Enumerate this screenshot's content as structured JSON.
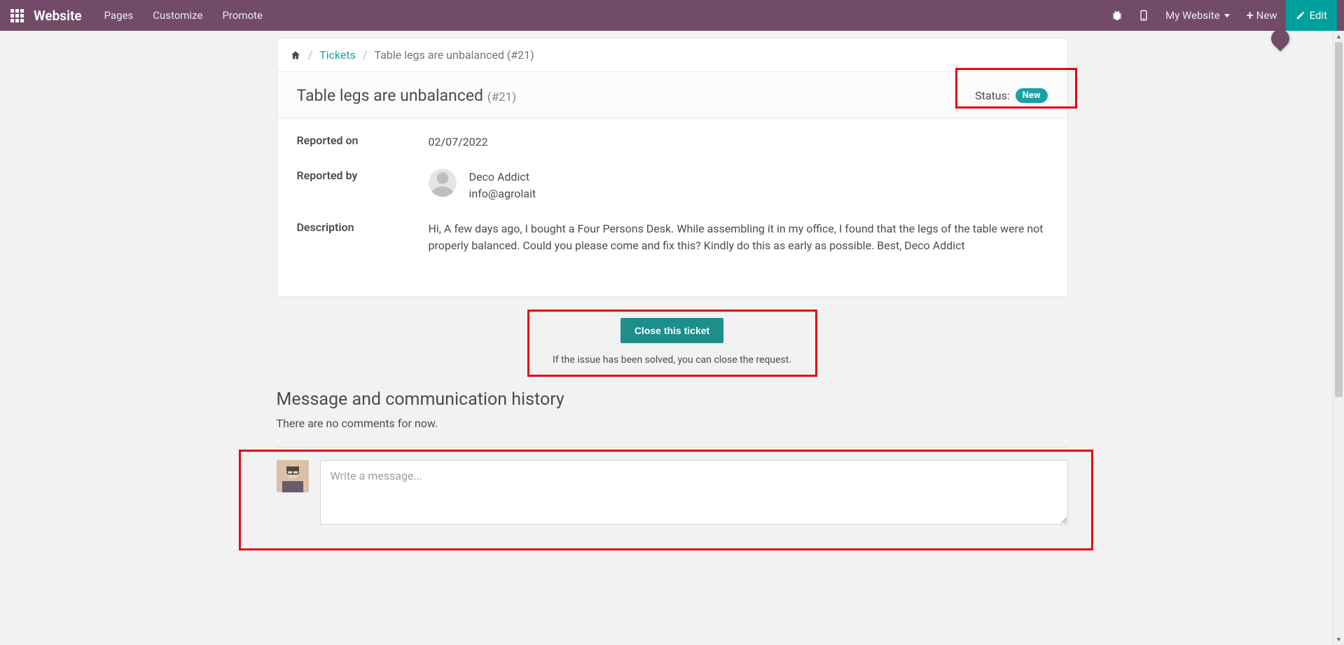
{
  "nav": {
    "brand": "Website",
    "items": [
      "Pages",
      "Customize",
      "Promote"
    ],
    "my_website": "My Website",
    "new_label": "New",
    "edit_label": "Edit"
  },
  "breadcrumb": {
    "home_aria": "Home",
    "tickets": "Tickets",
    "current": "Table legs are unbalanced (#21)"
  },
  "ticket": {
    "title": "Table legs are unbalanced",
    "id_suffix": "(#21)",
    "status_label": "Status:",
    "status_value": "New",
    "fields": {
      "reported_on_label": "Reported on",
      "reported_on_value": "02/07/2022",
      "reported_by_label": "Reported by",
      "reporter_name": "Deco Addict",
      "reporter_email": "info@agrolait",
      "description_label": "Description",
      "description_value": "Hi, A few days ago, I bought a Four Persons Desk. While assembling it in my office, I found that the legs of the table were not properly balanced. Could you please come and fix this? Kindly do this as early as possible. Best, Deco Addict"
    }
  },
  "close": {
    "button": "Close this ticket",
    "caption": "If the issue has been solved, you can close the request."
  },
  "messages": {
    "heading": "Message and communication history",
    "empty": "There are no comments for now.",
    "placeholder": "Write a message..."
  }
}
